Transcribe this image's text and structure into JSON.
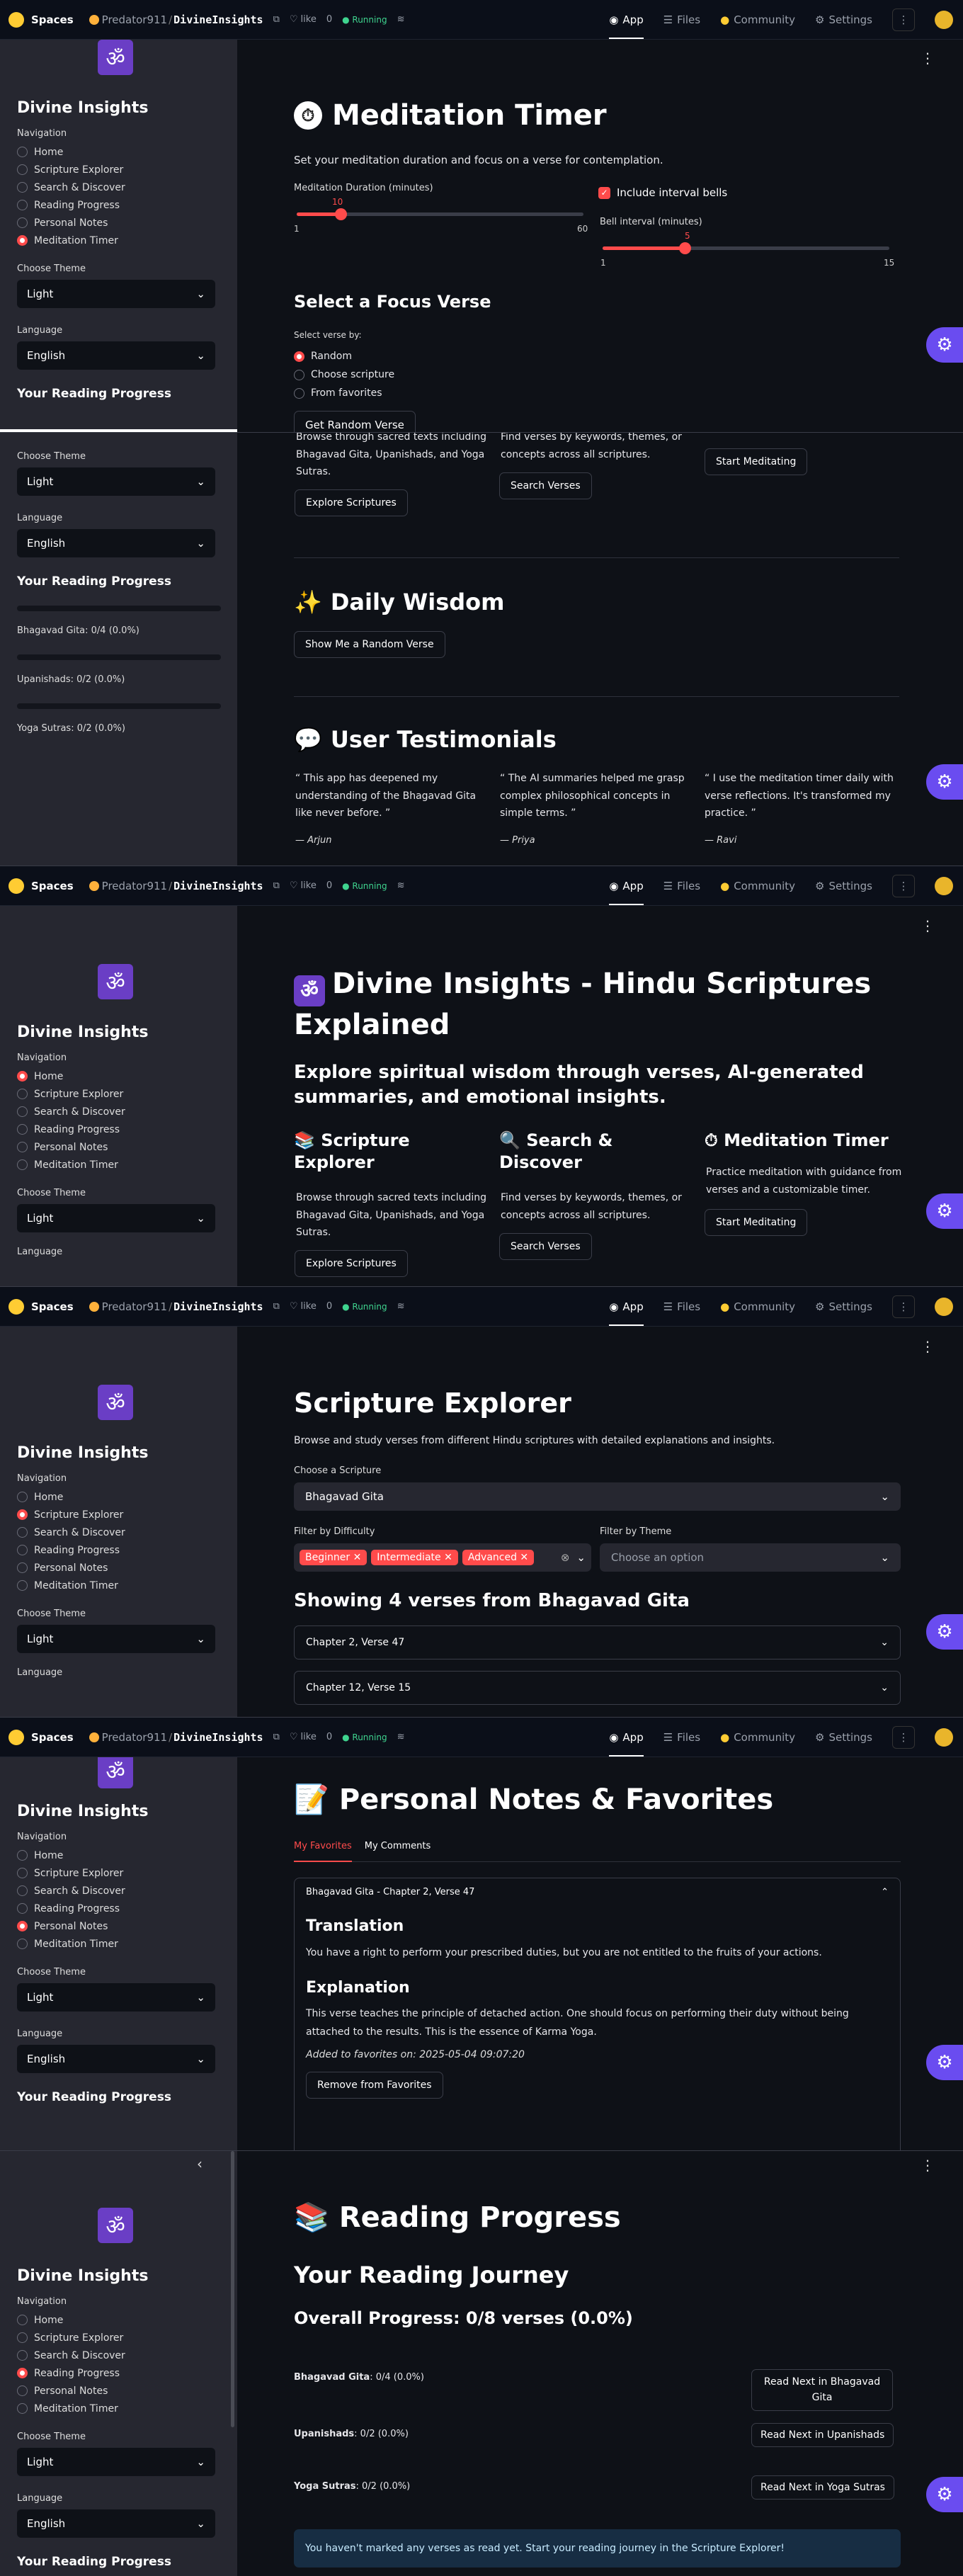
{
  "hf": {
    "spaces": "Spaces",
    "user": "Predator911",
    "repo": "DivineInsights",
    "like": "like",
    "likes": "0",
    "status": "Running",
    "tabs": [
      "App",
      "Files",
      "Community",
      "Settings"
    ]
  },
  "sidebar": {
    "title": "Divine Insights",
    "nav_label": "Navigation",
    "nav": [
      "Home",
      "Scripture Explorer",
      "Search & Discover",
      "Reading Progress",
      "Personal Notes",
      "Meditation Timer"
    ],
    "theme_label": "Choose Theme",
    "theme": "Light",
    "lang_label": "Language",
    "lang": "English",
    "progress_title": "Your Reading Progress",
    "progress": [
      "Bhagavad Gita: 0/4 (0.0%)",
      "Upanishads: 0/2 (0.0%)",
      "Yoga Sutras: 0/2 (0.0%)"
    ]
  },
  "meditation": {
    "title": "Meditation Timer",
    "intro": "Set your meditation duration and focus on a verse for contemplation.",
    "duration_label": "Meditation Duration (minutes)",
    "duration_value": "10",
    "duration_min": "1",
    "duration_max": "60",
    "duration_frac": 0.153,
    "interval_label": "Include interval bells",
    "bell_label": "Bell interval (minutes)",
    "bell_value": "5",
    "bell_min": "1",
    "bell_max": "15",
    "bell_frac": 0.286,
    "focus_title": "Select a Focus Verse",
    "select_by": "Select verse by:",
    "options": [
      "Random",
      "Choose scripture",
      "From favorites"
    ],
    "btn": "Get Random Verse"
  },
  "home_lower": {
    "col1_text": "Browse through sacred texts including Bhagavad Gita, Upanishads, and Yoga Sutras.",
    "col1_btn": "Explore Scriptures",
    "col2_text": "Find verses by keywords, themes, or concepts across all scriptures.",
    "col2_btn": "Search Verses",
    "col3_btn": "Start Meditating",
    "wisdom_title": "Daily Wisdom",
    "wisdom_btn": "Show Me a Random Verse",
    "testi_title": "User Testimonials",
    "testimonials": [
      {
        "q": "“ This app has deepened my understanding of the Bhagavad Gita like never before. ”",
        "a": "— Arjun"
      },
      {
        "q": "“ The AI summaries helped me grasp complex philosophical concepts in simple terms. ”",
        "a": "— Priya"
      },
      {
        "q": "“ I use the meditation timer daily with verse reflections. It's transformed my practice. ”",
        "a": "— Ravi"
      }
    ]
  },
  "home": {
    "title": "Divine Insights - Hindu Scriptures Explained",
    "subtitle": "Explore spiritual wisdom through verses, AI-generated summaries, and emotional insights.",
    "col1_title": "Scripture Explorer",
    "col2_title": "Search & Discover",
    "col3_title": "Meditation Timer",
    "col1_text": "Browse through sacred texts including Bhagavad Gita, Upanishads, and Yoga Sutras.",
    "col2_text": "Find verses by keywords, themes, or concepts across all scriptures.",
    "col3_text": "Practice meditation with guidance from verses and a customizable timer.",
    "col1_btn": "Explore Scriptures",
    "col2_btn": "Search Verses",
    "col3_btn": "Start Meditating"
  },
  "explorer": {
    "title": "Scripture Explorer",
    "intro": "Browse and study verses from different Hindu scriptures with detailed explanations and insights.",
    "choose_label": "Choose a Scripture",
    "choose_value": "Bhagavad Gita",
    "difficulty_label": "Filter by Difficulty",
    "chips": [
      "Beginner",
      "Intermediate",
      "Advanced"
    ],
    "theme_label": "Filter by Theme",
    "theme_placeholder": "Choose an option",
    "showing": "Showing 4 verses from Bhagavad Gita",
    "verses": [
      "Chapter 2, Verse 47",
      "Chapter 12, Verse 15"
    ]
  },
  "notes": {
    "title": "Personal Notes & Favorites",
    "tabs": [
      "My Favorites",
      "My Comments"
    ],
    "card_title": "Bhagavad Gita - Chapter 2, Verse 47",
    "translation_h": "Translation",
    "translation": "You have a right to perform your prescribed duties, but you are not entitled to the fruits of your actions.",
    "explanation_h": "Explanation",
    "explanation": "This verse teaches the principle of detached action. One should focus on performing their duty without being attached to the results. This is the essence of Karma Yoga.",
    "added": "Added to favorites on: 2025-05-04 09:07:20",
    "remove_btn": "Remove from Favorites"
  },
  "progress": {
    "title": "Reading Progress",
    "journey": "Your Reading Journey",
    "overall": "Overall Progress: 0/8 verses (0.0%)",
    "rows": [
      {
        "label": "Bhagavad Gita",
        "stat": ": 0/4 (0.0%)",
        "btn": "Read Next in Bhagavad Gita"
      },
      {
        "label": "Upanishads",
        "stat": ": 0/2 (0.0%)",
        "btn": "Read Next in Upanishads"
      },
      {
        "label": "Yoga Sutras",
        "stat": ": 0/2 (0.0%)",
        "btn": "Read Next in Yoga Sutras"
      }
    ],
    "info": "You haven't marked any verses as read yet. Start your reading journey in the Scripture Explorer!"
  }
}
